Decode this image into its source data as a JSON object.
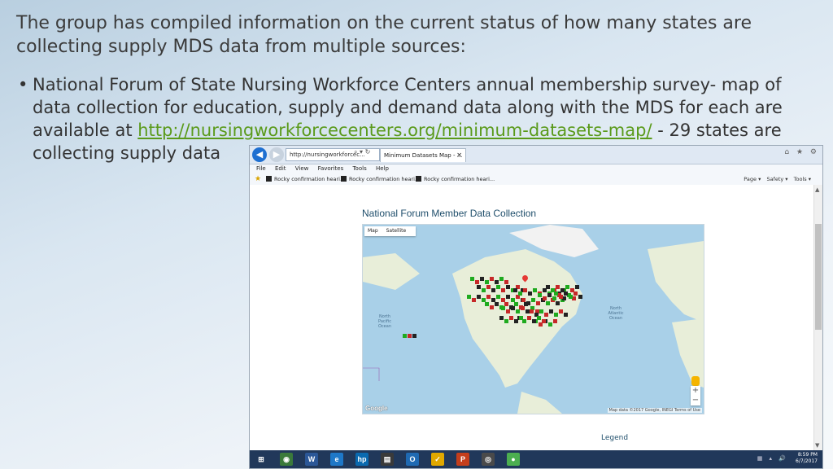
{
  "slide": {
    "heading": "The group has compiled information on the current status of how many states are collecting supply MDS data from multiple sources:",
    "bullet_marker": "•",
    "bullet_before": "National Forum of State Nursing Workforce Centers annual membership survey- map of data collection for education, supply and demand data along with the MDS for each are available at ",
    "bullet_link": "http://nursingworkforcecenters.org/minimum-datasets-map/",
    "bullet_after": " - 29 states are collecting supply data"
  },
  "browser": {
    "address": "http://nursingworkforcec...",
    "address_controls": "⌕ ▾ ↻",
    "tab_title": "Minimum Datasets Map - ...",
    "tab_close": "✕",
    "window_controls": "⌂ ★ ⚙",
    "menu": [
      "File",
      "Edit",
      "View",
      "Favorites",
      "Tools",
      "Help"
    ],
    "favorites": [
      "Rocky confirmation heari...",
      "Rocky confirmation heari...",
      "Rocky confirmation heari..."
    ],
    "command_bar": [
      "Page ▾",
      "Safety ▾",
      "Tools ▾"
    ]
  },
  "page": {
    "title": "National Forum Member Data Collection",
    "map_tabs": [
      "Map",
      "Satellite"
    ],
    "ocean_labels": [
      "North Pacific Ocean",
      "North Atlantic Ocean"
    ],
    "google_logo": "Google",
    "attribution": "Map data ©2017 Google, INEGI  Terms of Use",
    "zoom_in": "+",
    "zoom_out": "−",
    "legend": "Legend"
  },
  "taskbar": {
    "apps": [
      {
        "icon": "windows-start-icon",
        "glyph": "⊞",
        "color": "#21385a"
      },
      {
        "icon": "chrome-icon",
        "glyph": "◉",
        "color": "#3b7a3b"
      },
      {
        "icon": "word-icon",
        "glyph": "W",
        "color": "#2b5797"
      },
      {
        "icon": "ie-icon",
        "glyph": "e",
        "color": "#1e78c8"
      },
      {
        "icon": "hp-icon",
        "glyph": "hp",
        "color": "#0a6ab0"
      },
      {
        "icon": "file-icon",
        "glyph": "▤",
        "color": "#3a3a3a"
      },
      {
        "icon": "outlook-icon",
        "glyph": "O",
        "color": "#1f6ab3"
      },
      {
        "icon": "norton-icon",
        "glyph": "✓",
        "color": "#e0a800"
      },
      {
        "icon": "powerpoint-icon",
        "glyph": "P",
        "color": "#c43e1c"
      },
      {
        "icon": "eye-icon",
        "glyph": "◎",
        "color": "#4a4a4a"
      },
      {
        "icon": "chat-icon",
        "glyph": "●",
        "color": "#4caf50"
      }
    ],
    "tray": "▦ ▴ 🔊",
    "time": "8:59 PM",
    "date": "6/7/2017"
  },
  "colors": {
    "marker_green": "#1faa1f",
    "marker_red": "#c62828",
    "marker_black": "#222222",
    "link": "#5a9a1a"
  }
}
